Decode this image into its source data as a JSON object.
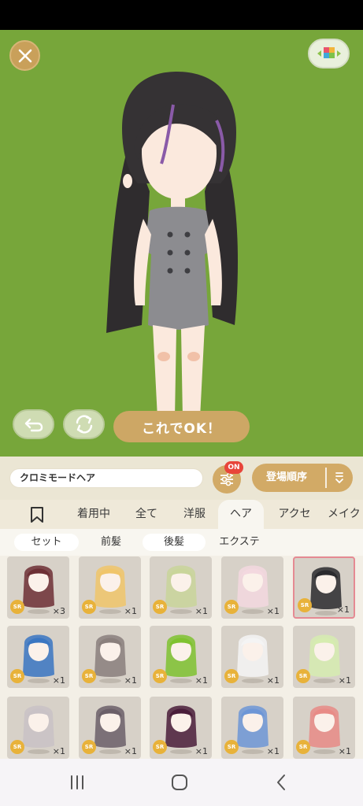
{
  "toolbar": {
    "close_icon": "close-icon",
    "palette_icon": "palette-icon",
    "undo_icon": "undo-icon",
    "rotate_icon": "rotate-icon",
    "ok_label": "これでOK！"
  },
  "search": {
    "value": "クロミモードヘア",
    "filter_badge": "ON",
    "sort_label": "登場順序"
  },
  "categories": {
    "bookmark_icon": "bookmark-icon",
    "tabs": [
      "着用中",
      "全て",
      "洋服",
      "ヘア",
      "アクセ",
      "メイク"
    ],
    "active": "ヘア"
  },
  "subcategories": {
    "tabs": [
      "セット",
      "前髪",
      "後髪",
      "エクステ"
    ],
    "active": "後髪"
  },
  "items": [
    {
      "rarity": "SR",
      "qty": "×3",
      "hair": "#6d2f35"
    },
    {
      "rarity": "SR",
      "qty": "×1",
      "hair": "#f0c56a"
    },
    {
      "rarity": "SR",
      "qty": "×1",
      "hair": "#c9d59a"
    },
    {
      "rarity": "SR",
      "qty": "×1",
      "hair": "#f3d8df"
    },
    {
      "rarity": "SR",
      "qty": "×1",
      "hair": "#2a2a2e",
      "selected": true
    },
    {
      "rarity": "SR",
      "qty": "×1",
      "hair": "#3a76c2"
    },
    {
      "rarity": "SR",
      "qty": "×1",
      "hair": "#8a7f7c"
    },
    {
      "rarity": "SR",
      "qty": "×1",
      "hair": "#7fc230"
    },
    {
      "rarity": "SR",
      "qty": "×1",
      "hair": "#f4f4f4"
    },
    {
      "rarity": "SR",
      "qty": "×1",
      "hair": "#d6ecb0"
    },
    {
      "rarity": "SR",
      "qty": "×1",
      "hair": "#c9c2c6"
    },
    {
      "rarity": "SR",
      "qty": "×1",
      "hair": "#6b5f68"
    },
    {
      "rarity": "SR",
      "qty": "×1",
      "hair": "#4a1d3a"
    },
    {
      "rarity": "SR",
      "qty": "×1",
      "hair": "#6d96d6"
    },
    {
      "rarity": "SR",
      "qty": "×1",
      "hair": "#e88b86"
    }
  ],
  "navigation": {
    "recents_icon": "recents-icon",
    "home_icon": "home-icon",
    "back_icon": "back-icon"
  },
  "colors": {
    "stage_bg": "#77a63a",
    "accent": "#d2aa66",
    "badge_red": "#e8453a",
    "sr_gold": "#e8b23a"
  }
}
